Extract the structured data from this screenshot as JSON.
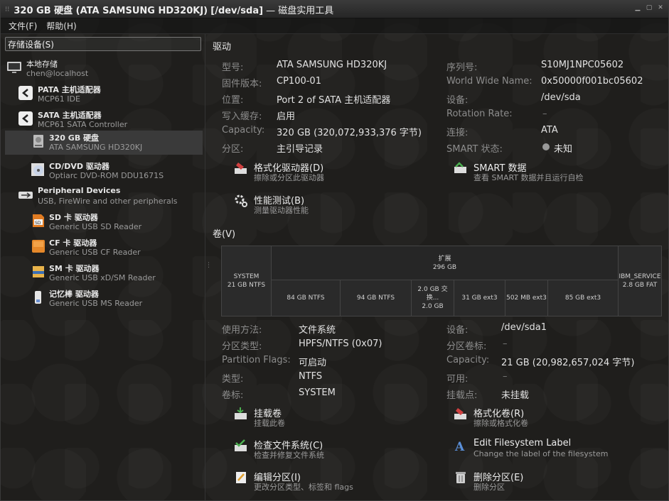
{
  "window": {
    "title_prefix": "320 GB 硬盘 (ATA SAMSUNG HD320KJ)",
    "title_path": "[/dev/sda]",
    "title_suffix": " — 磁盘实用工具"
  },
  "menu": {
    "file": "文件(F)",
    "help": "帮助(H)"
  },
  "sidebar": {
    "header": "存储设备(S)",
    "items": [
      {
        "title": "本地存储",
        "subtitle": "chen@localhost",
        "icon": "computer-icon"
      },
      {
        "title": "PATA 主机适配器",
        "subtitle": "MCP61 IDE",
        "icon": "controller-icon"
      },
      {
        "title": "SATA 主机适配器",
        "subtitle": "MCP61 SATA Controller",
        "icon": "controller-icon"
      },
      {
        "title": "320 GB 硬盘",
        "subtitle": "ATA SAMSUNG HD320KJ",
        "icon": "harddisk-icon"
      },
      {
        "title": "CD/DVD 驱动器",
        "subtitle": "Optiarc DVD-ROM DDU1671S",
        "icon": "optical-drive-icon"
      },
      {
        "title": "Peripheral Devices",
        "subtitle": "USB, FireWire and other peripherals",
        "icon": "usb-icon"
      },
      {
        "title": "SD 卡 驱动器",
        "subtitle": "Generic USB SD Reader",
        "icon": "sd-card-icon"
      },
      {
        "title": "CF 卡 驱动器",
        "subtitle": "Generic USB CF Reader",
        "icon": "cf-card-icon"
      },
      {
        "title": "SM 卡 驱动器",
        "subtitle": "Generic USB xD/SM Reader",
        "icon": "sm-card-icon"
      },
      {
        "title": "记忆棒 驱动器",
        "subtitle": "Generic USB MS Reader",
        "icon": "memory-stick-icon"
      }
    ]
  },
  "drive": {
    "heading": "驱动",
    "left": [
      {
        "label": "型号:",
        "value": "ATA SAMSUNG HD320KJ"
      },
      {
        "label": "固件版本:",
        "value": "CP100-01"
      },
      {
        "label": "位置:",
        "value": "Port 2 of SATA 主机适配器"
      },
      {
        "label": "写入缓存:",
        "value": "启用"
      },
      {
        "label": "Capacity:",
        "value": "320 GB (320,072,933,376 字节)"
      },
      {
        "label": "分区:",
        "value": "主引导记录"
      }
    ],
    "right": [
      {
        "label": "序列号:",
        "value": "S10MJ1NPC05602"
      },
      {
        "label": "World Wide Name:",
        "value": "0x50000f001bc05602"
      },
      {
        "label": "设备:",
        "value": "/dev/sda"
      },
      {
        "label": "Rotation Rate:",
        "value": "–"
      },
      {
        "label": "连接:",
        "value": "ATA"
      },
      {
        "label": "SMART 状态:",
        "value": "未知"
      }
    ],
    "actions": [
      {
        "title": "格式化驱动器(D)",
        "subtitle": "擦除或分区此驱动器",
        "icon": "format-drive-icon"
      },
      {
        "title": "SMART 数据",
        "subtitle": "查看 SMART 数据并且运行自检",
        "icon": "smart-data-icon"
      },
      {
        "title": "性能测试(B)",
        "subtitle": "测量驱动器性能",
        "icon": "benchmark-icon"
      }
    ]
  },
  "volumes": {
    "heading": "卷(V)",
    "segments": {
      "system": [
        "SYSTEM",
        "21 GB NTFS"
      ],
      "extended": [
        "扩展",
        "296 GB"
      ],
      "ibm": [
        "IBM_SERVICE",
        "2.8 GB FAT"
      ],
      "logical": [
        [
          "84 GB NTFS"
        ],
        [
          "94 GB NTFS"
        ],
        [
          "2.0 GB 交换...",
          "2.0 GB"
        ],
        [
          "31 GB ext3"
        ],
        [
          "502 MB ext3"
        ],
        [
          "85 GB ext3"
        ]
      ]
    },
    "left": [
      {
        "label": "使用方法:",
        "value": "文件系统"
      },
      {
        "label": "分区类型:",
        "value": "HPFS/NTFS (0x07)"
      },
      {
        "label": "Partition Flags:",
        "value": "可启动"
      },
      {
        "label": "类型:",
        "value": "NTFS"
      },
      {
        "label": "卷标:",
        "value": "SYSTEM"
      }
    ],
    "right": [
      {
        "label": "设备:",
        "value": "/dev/sda1"
      },
      {
        "label": "分区卷标:",
        "value": "–"
      },
      {
        "label": "Capacity:",
        "value": "21 GB (20,982,657,024 字节)"
      },
      {
        "label": "可用:",
        "value": "–"
      },
      {
        "label": "挂载点:",
        "value": "未挂载"
      }
    ],
    "actions": [
      {
        "title": "挂载卷",
        "subtitle": "挂载此卷",
        "icon": "mount-icon"
      },
      {
        "title": "格式化卷(R)",
        "subtitle": "擦除或格式化卷",
        "icon": "format-volume-icon"
      },
      {
        "title": "检查文件系统(C)",
        "subtitle": "检查并修复文件系统",
        "icon": "check-filesystem-icon"
      },
      {
        "title": "Edit Filesystem Label",
        "subtitle": "Change the label of the filesystem",
        "icon": "edit-label-icon"
      },
      {
        "title": "编辑分区(I)",
        "subtitle": "更改分区类型、标签和 flags",
        "icon": "edit-partition-icon"
      },
      {
        "title": "删除分区(E)",
        "subtitle": "删除分区",
        "icon": "delete-partition-icon"
      }
    ]
  }
}
